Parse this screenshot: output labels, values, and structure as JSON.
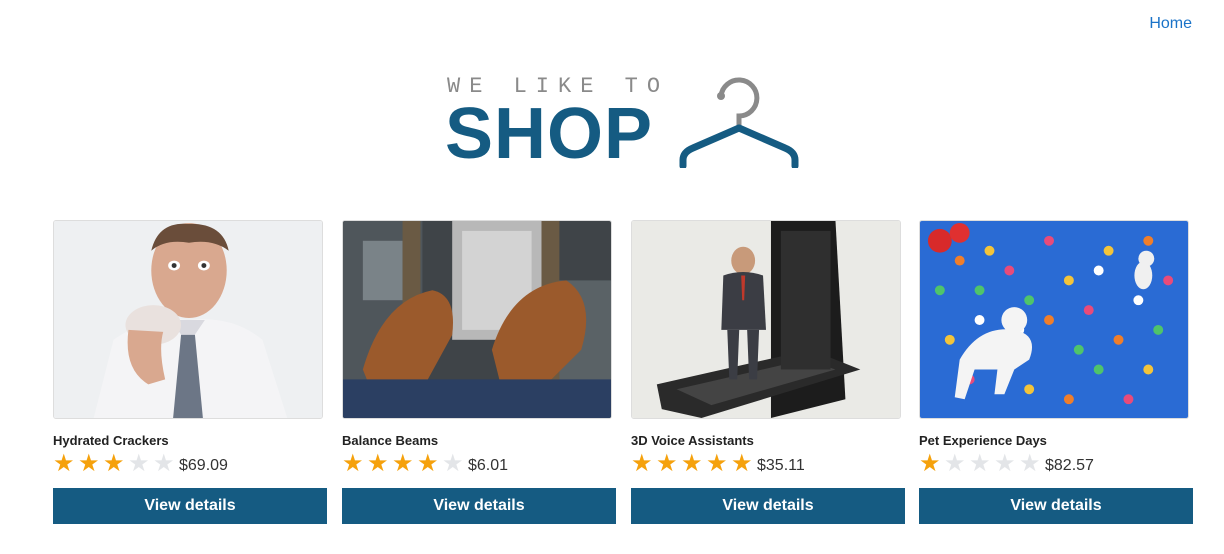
{
  "nav": {
    "home_label": "Home"
  },
  "logo": {
    "top_text": "WE LIKE TO",
    "main_text": "SHOP",
    "brand_color": "#155b82",
    "top_color": "#8a8a8a",
    "icon": "hanger-icon"
  },
  "colors": {
    "accent": "#155b82",
    "star_on": "#f5a10c",
    "star_off": "#e3e5e8",
    "link": "#1a73c8"
  },
  "products": [
    {
      "title": "Hydrated Crackers",
      "rating": 3,
      "max_rating": 5,
      "price": "$69.09",
      "button_label": "View details",
      "image": "man-eating-cracker"
    },
    {
      "title": "Balance Beams",
      "rating": 4,
      "max_rating": 5,
      "price": "$6.01",
      "button_label": "View details",
      "image": "feet-over-city"
    },
    {
      "title": "3D Voice Assistants",
      "rating": 5,
      "max_rating": 5,
      "price": "$35.11",
      "button_label": "View details",
      "image": "hologram-man-on-phone"
    },
    {
      "title": "Pet Experience Days",
      "rating": 1,
      "max_rating": 5,
      "price": "$82.57",
      "button_label": "View details",
      "image": "dogs-with-balloons"
    }
  ]
}
